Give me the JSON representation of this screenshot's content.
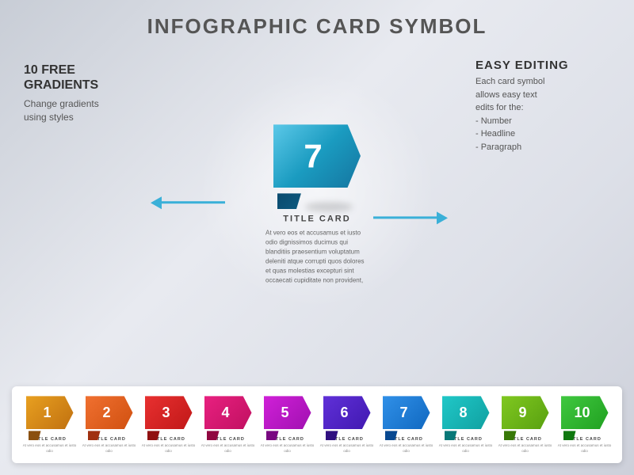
{
  "title": "INFOGRAPHIC CARD SYMBOL",
  "left": {
    "headline": "10 FREE\nGRADIENTS",
    "subtitle": "Change gradients\nusing styles"
  },
  "right": {
    "headline": "EASY EDITING",
    "text": "Each card symbol allows easy text edits for the:\n- Number\n- Headline\n- Paragraph"
  },
  "center_card": {
    "number": "7",
    "title": "TITLE CARD",
    "paragraph": "At vero eos et accusamus et iusto odio dignissimos ducimus qui blanditiis praesentium voluptatum deleniti atque corrupti quos dolores et quas molestias excepturi sint occaecati cupiditate non provident,"
  },
  "mini_cards": [
    {
      "number": "1",
      "color1": "#e8a020",
      "color2": "#c07010",
      "fold_color": "#8a5010",
      "title": "TITLE CARD",
      "text": "At vero eos et accusamus et iusto odio"
    },
    {
      "number": "2",
      "color1": "#f07030",
      "color2": "#d05010",
      "fold_color": "#a03010",
      "title": "TITLE CARD",
      "text": "At vero eos et accusamus et iusto odio"
    },
    {
      "number": "3",
      "color1": "#e83030",
      "color2": "#c01818",
      "fold_color": "#901010",
      "title": "TITLE CARD",
      "text": "At vero eos et accusamus et iusto odio"
    },
    {
      "number": "4",
      "color1": "#e82080",
      "color2": "#c01060",
      "fold_color": "#900840",
      "title": "TITLE CARD",
      "text": "At vero eos et accusamus et iusto odio"
    },
    {
      "number": "5",
      "color1": "#d020d8",
      "color2": "#a010b0",
      "fold_color": "#780880",
      "title": "TITLE CARD",
      "text": "At vero eos et accusamus et iusto odio"
    },
    {
      "number": "6",
      "color1": "#6030d8",
      "color2": "#4018b0",
      "fold_color": "#301080",
      "title": "TITLE CARD",
      "text": "At vero eos et accusamus et iusto odio"
    },
    {
      "number": "7",
      "color1": "#3090e8",
      "color2": "#1068c0",
      "fold_color": "#084890",
      "title": "TITLE CARD",
      "text": "At vero eos et accusamus et iusto odio"
    },
    {
      "number": "8",
      "color1": "#20c8c8",
      "color2": "#10a0a0",
      "fold_color": "#087878",
      "title": "TITLE CARD",
      "text": "At vero eos et accusamus et iusto odio"
    },
    {
      "number": "9",
      "color1": "#80c820",
      "color2": "#58a010",
      "fold_color": "#387808",
      "title": "TITLE CARD",
      "text": "At vero eos et accusamus et iusto odio"
    },
    {
      "number": "10",
      "color1": "#40c840",
      "color2": "#20a020",
      "fold_color": "#107810",
      "title": "TITLE CARD",
      "text": "At vero eos et accusamus et iusto odio"
    }
  ]
}
